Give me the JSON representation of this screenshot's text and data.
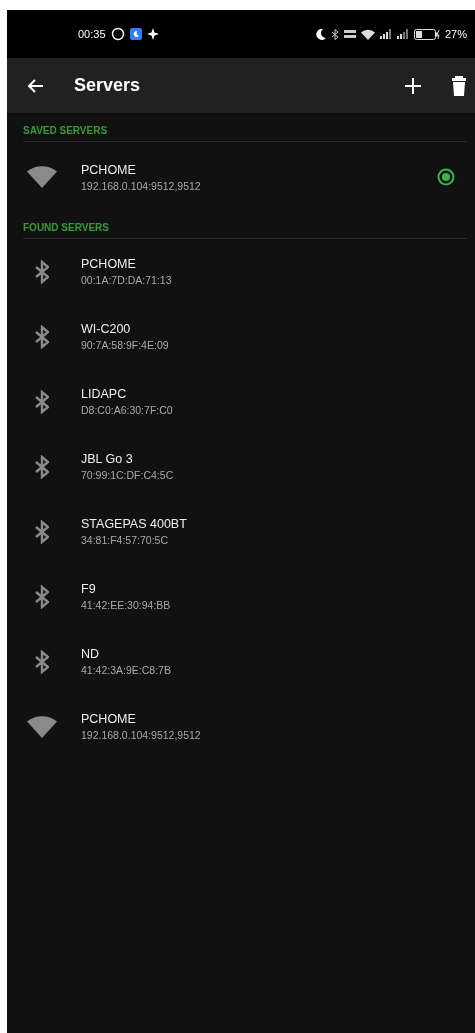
{
  "status_bar": {
    "time": "00:35",
    "battery": "27%"
  },
  "app_bar": {
    "title": "Servers"
  },
  "saved_servers": {
    "header": "SAVED SERVERS",
    "items": [
      {
        "kind": "wifi",
        "name": "PCHOME",
        "address": "192.168.0.104:9512,9512",
        "selected": true
      }
    ]
  },
  "found_servers": {
    "header": "FOUND SERVERS",
    "items": [
      {
        "kind": "bluetooth",
        "name": "PCHOME",
        "address": "00:1A:7D:DA:71:13"
      },
      {
        "kind": "bluetooth",
        "name": "WI-C200",
        "address": "90:7A:58:9F:4E:09"
      },
      {
        "kind": "bluetooth",
        "name": "LIDAPC",
        "address": "D8:C0:A6:30:7F:C0"
      },
      {
        "kind": "bluetooth",
        "name": "JBL Go 3",
        "address": "70:99:1C:DF:C4:5C"
      },
      {
        "kind": "bluetooth",
        "name": "STAGEPAS 400BT",
        "address": "34:81:F4:57:70:5C"
      },
      {
        "kind": "bluetooth",
        "name": "F9",
        "address": "41:42:EE:30:94:BB"
      },
      {
        "kind": "bluetooth",
        "name": "ND",
        "address": "41:42:3A:9E:C8:7B"
      },
      {
        "kind": "wifi",
        "name": "PCHOME",
        "address": "192.168.0.104:9512,9512"
      }
    ]
  }
}
